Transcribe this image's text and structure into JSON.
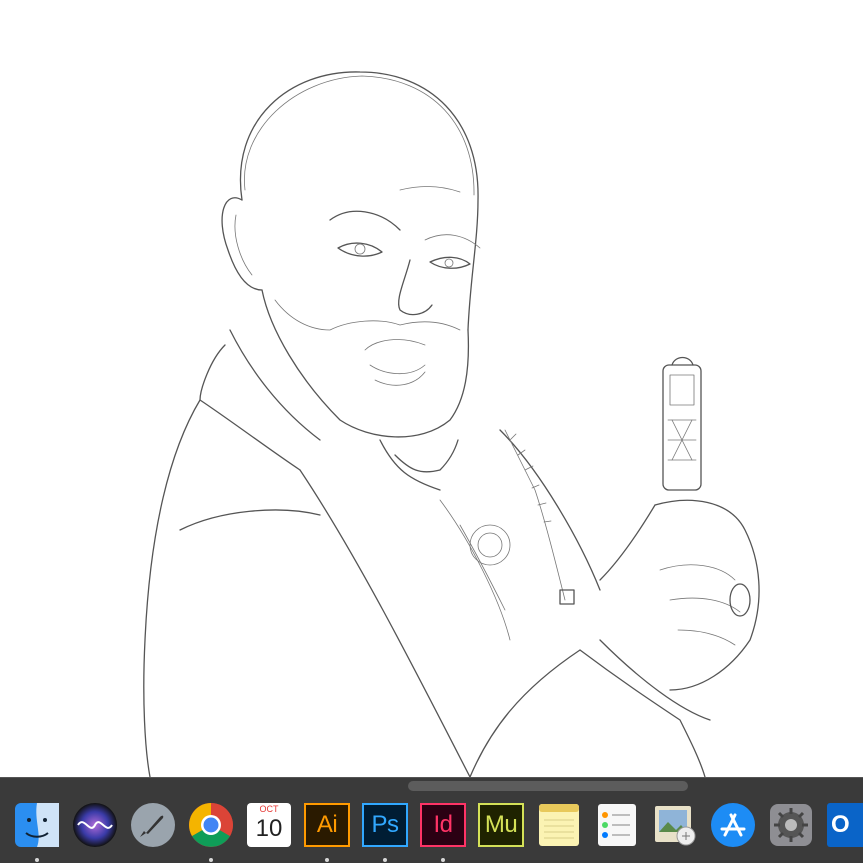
{
  "dock": {
    "items": [
      {
        "name": "finder-icon",
        "label": "",
        "running": true
      },
      {
        "name": "siri-icon",
        "label": "",
        "running": false
      },
      {
        "name": "launchpad-icon",
        "label": "",
        "running": false
      },
      {
        "name": "chrome-icon",
        "label": "",
        "running": true
      },
      {
        "name": "calendar-icon",
        "label": "",
        "running": false
      },
      {
        "name": "illustrator-icon",
        "label": "Ai",
        "running": true
      },
      {
        "name": "photoshop-icon",
        "label": "Ps",
        "running": true
      },
      {
        "name": "indesign-icon",
        "label": "Id",
        "running": true
      },
      {
        "name": "muse-icon",
        "label": "Mu",
        "running": false
      },
      {
        "name": "notes-icon",
        "label": "",
        "running": false
      },
      {
        "name": "reminders-icon",
        "label": "",
        "running": false
      },
      {
        "name": "preview-icon",
        "label": "",
        "running": false
      },
      {
        "name": "app-store-icon",
        "label": "",
        "running": false
      },
      {
        "name": "system-preferences-icon",
        "label": "",
        "running": false
      },
      {
        "name": "outlook-icon",
        "label": "O",
        "running": false
      }
    ],
    "calendar": {
      "month": "OCT",
      "day": "10"
    },
    "colors": {
      "illustrator": "#ff9a00",
      "photoshop": "#31a8ff",
      "indesign": "#ff3366",
      "muse": "#d4e157",
      "dock_bg": "#3a3a3a"
    }
  }
}
